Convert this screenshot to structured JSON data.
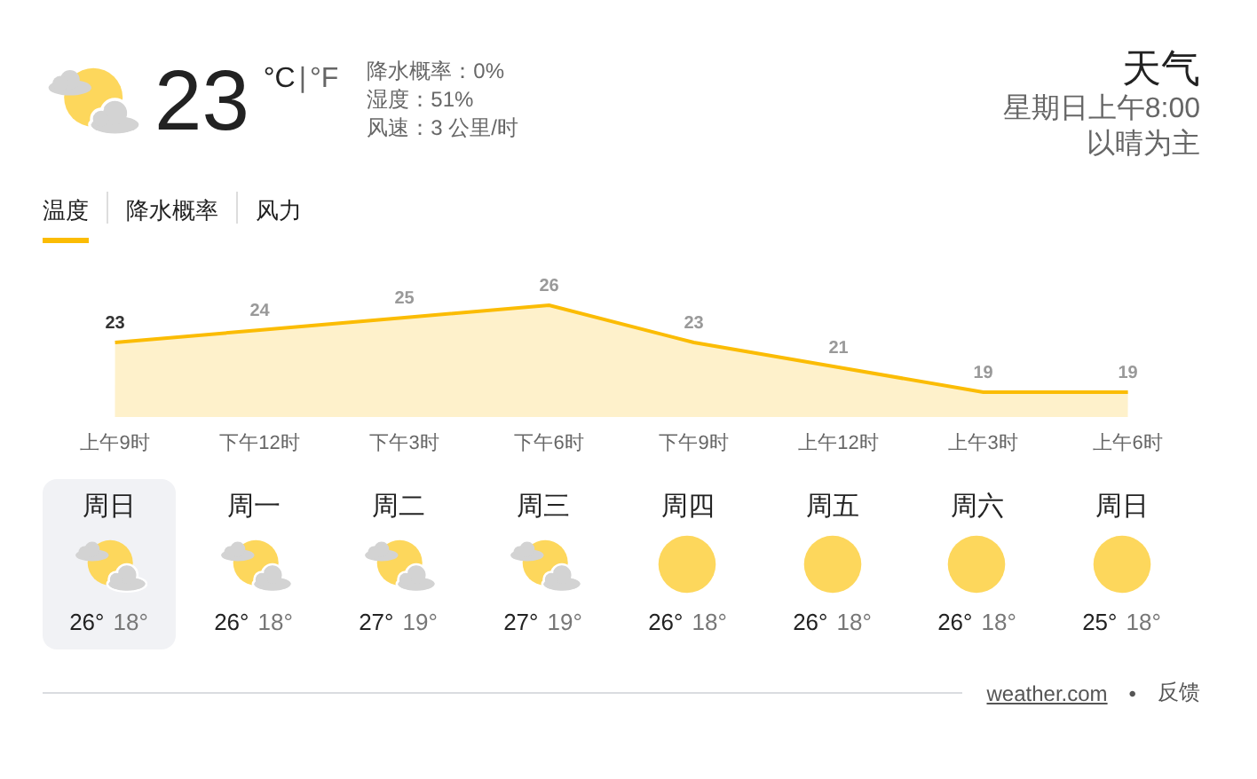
{
  "current": {
    "kind": "partly-cloudy",
    "temperature": "23",
    "unit_c": "°C",
    "separator": "|",
    "unit_f": "°F",
    "details": [
      "降水概率：0%",
      "湿度：51%",
      "风速：3 公里/时"
    ]
  },
  "header": {
    "title": "天气",
    "time": "星期日上午8:00",
    "condition": "以晴为主"
  },
  "tabs": [
    {
      "label": "温度",
      "selected": true
    },
    {
      "label": "降水概率",
      "selected": false
    },
    {
      "label": "风力",
      "selected": false
    }
  ],
  "chart_data": {
    "type": "area",
    "categories": [
      "上午9时",
      "下午12时",
      "下午3时",
      "下午6时",
      "下午9时",
      "上午12时",
      "上午3时",
      "上午6时"
    ],
    "values": [
      23,
      24,
      25,
      26,
      23,
      21,
      19,
      19
    ],
    "data_labels": true
  },
  "days": [
    {
      "name": "周日",
      "kind": "partly-cloudy",
      "high": "26°",
      "low": "18°",
      "selected": true
    },
    {
      "name": "周一",
      "kind": "partly-cloudy",
      "high": "26°",
      "low": "18°",
      "selected": false
    },
    {
      "name": "周二",
      "kind": "partly-cloudy",
      "high": "27°",
      "low": "19°",
      "selected": false
    },
    {
      "name": "周三",
      "kind": "partly-cloudy",
      "high": "27°",
      "low": "19°",
      "selected": false
    },
    {
      "name": "周四",
      "kind": "sunny",
      "high": "26°",
      "low": "18°",
      "selected": false
    },
    {
      "name": "周五",
      "kind": "sunny",
      "high": "26°",
      "low": "18°",
      "selected": false
    },
    {
      "name": "周六",
      "kind": "sunny",
      "high": "26°",
      "low": "18°",
      "selected": false
    },
    {
      "name": "周日",
      "kind": "sunny",
      "high": "25°",
      "low": "18°",
      "selected": false
    }
  ],
  "footer": {
    "source": "weather.com",
    "dot": "•",
    "feedback": "反馈"
  }
}
